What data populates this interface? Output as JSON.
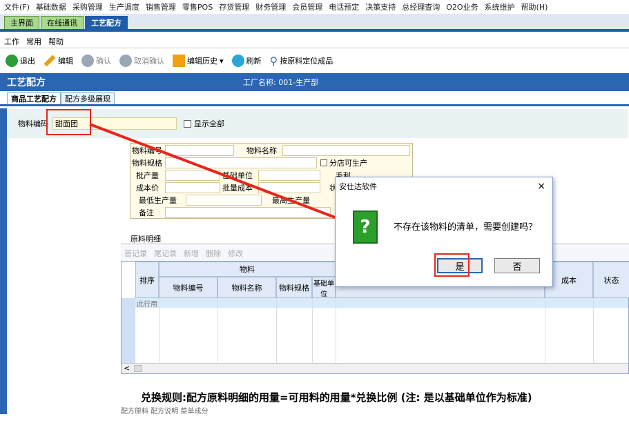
{
  "menubar": {
    "items": [
      "文件(F)",
      "基础数据",
      "采购管理",
      "生产调度",
      "销售管理",
      "零售POS",
      "存货管理",
      "财务管理",
      "会员管理",
      "电话预定",
      "决策支持",
      "总经理查询",
      "O2O业务",
      "系统维护",
      "帮助(H)"
    ]
  },
  "tabs": [
    "主界面",
    "在线通讯",
    "工艺配方"
  ],
  "submenu": [
    "工作",
    "常用",
    "帮助"
  ],
  "toolbar": {
    "exit": "退出",
    "edit": "编辑",
    "confirm": "确认",
    "cancel_confirm": "取消确认",
    "edit_history": "编辑历史",
    "refresh": "刷新",
    "locate": "按原料定位成品"
  },
  "window": {
    "title": "工艺配方",
    "factory": "工厂名称: 001-生产部"
  },
  "inner_tabs": [
    "商品工艺配方",
    "配方多级展现"
  ],
  "search": {
    "label": "物料编码",
    "value": "甜面团",
    "show_all": "显示全部"
  },
  "form": {
    "code": "物料编号",
    "name": "物料名称",
    "spec": "物料规格",
    "branch": "分店可生产",
    "batch": "批产量",
    "base_unit": "基础单位",
    "gross": "毛利",
    "cost_price": "成本价",
    "batch_cost": "批量成本",
    "status": "状",
    "min_prod": "最低生产量",
    "max_prod": "最高生产量",
    "remark": "备注"
  },
  "detail": {
    "title": "原料明细",
    "actions": [
      "首记录",
      "尾记录",
      "新增",
      "删除",
      "修改"
    ]
  },
  "grid": {
    "sort": "排序",
    "group": "物料",
    "code": "物料编号",
    "name": "物料名称",
    "spec": "物料规格",
    "unit": "基础单位",
    "cost": "成本",
    "status": "状态",
    "row": "此行用"
  },
  "note": "兑换规则:配方原料明细的用量=可用料的用量*兑换比例  (注: 是以基础单位作为标准)",
  "bottom_tabs": "配方原料   配方说明   菜单成分",
  "dialog": {
    "title": "安仕达软件",
    "message": "不存在该物料的清单，需要创建吗？",
    "yes": "是",
    "no": "否",
    "close": "×"
  }
}
